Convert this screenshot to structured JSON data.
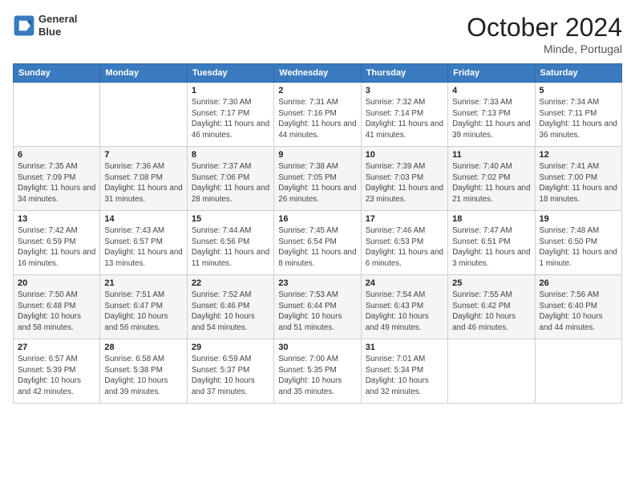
{
  "header": {
    "logo_line1": "General",
    "logo_line2": "Blue",
    "month": "October 2024",
    "location": "Minde, Portugal"
  },
  "weekdays": [
    "Sunday",
    "Monday",
    "Tuesday",
    "Wednesday",
    "Thursday",
    "Friday",
    "Saturday"
  ],
  "weeks": [
    [
      {
        "day": "",
        "info": ""
      },
      {
        "day": "",
        "info": ""
      },
      {
        "day": "1",
        "info": "Sunrise: 7:30 AM\nSunset: 7:17 PM\nDaylight: 11 hours and 46 minutes."
      },
      {
        "day": "2",
        "info": "Sunrise: 7:31 AM\nSunset: 7:16 PM\nDaylight: 11 hours and 44 minutes."
      },
      {
        "day": "3",
        "info": "Sunrise: 7:32 AM\nSunset: 7:14 PM\nDaylight: 11 hours and 41 minutes."
      },
      {
        "day": "4",
        "info": "Sunrise: 7:33 AM\nSunset: 7:13 PM\nDaylight: 11 hours and 39 minutes."
      },
      {
        "day": "5",
        "info": "Sunrise: 7:34 AM\nSunset: 7:11 PM\nDaylight: 11 hours and 36 minutes."
      }
    ],
    [
      {
        "day": "6",
        "info": "Sunrise: 7:35 AM\nSunset: 7:09 PM\nDaylight: 11 hours and 34 minutes."
      },
      {
        "day": "7",
        "info": "Sunrise: 7:36 AM\nSunset: 7:08 PM\nDaylight: 11 hours and 31 minutes."
      },
      {
        "day": "8",
        "info": "Sunrise: 7:37 AM\nSunset: 7:06 PM\nDaylight: 11 hours and 28 minutes."
      },
      {
        "day": "9",
        "info": "Sunrise: 7:38 AM\nSunset: 7:05 PM\nDaylight: 11 hours and 26 minutes."
      },
      {
        "day": "10",
        "info": "Sunrise: 7:39 AM\nSunset: 7:03 PM\nDaylight: 11 hours and 23 minutes."
      },
      {
        "day": "11",
        "info": "Sunrise: 7:40 AM\nSunset: 7:02 PM\nDaylight: 11 hours and 21 minutes."
      },
      {
        "day": "12",
        "info": "Sunrise: 7:41 AM\nSunset: 7:00 PM\nDaylight: 11 hours and 18 minutes."
      }
    ],
    [
      {
        "day": "13",
        "info": "Sunrise: 7:42 AM\nSunset: 6:59 PM\nDaylight: 11 hours and 16 minutes."
      },
      {
        "day": "14",
        "info": "Sunrise: 7:43 AM\nSunset: 6:57 PM\nDaylight: 11 hours and 13 minutes."
      },
      {
        "day": "15",
        "info": "Sunrise: 7:44 AM\nSunset: 6:56 PM\nDaylight: 11 hours and 11 minutes."
      },
      {
        "day": "16",
        "info": "Sunrise: 7:45 AM\nSunset: 6:54 PM\nDaylight: 11 hours and 8 minutes."
      },
      {
        "day": "17",
        "info": "Sunrise: 7:46 AM\nSunset: 6:53 PM\nDaylight: 11 hours and 6 minutes."
      },
      {
        "day": "18",
        "info": "Sunrise: 7:47 AM\nSunset: 6:51 PM\nDaylight: 11 hours and 3 minutes."
      },
      {
        "day": "19",
        "info": "Sunrise: 7:48 AM\nSunset: 6:50 PM\nDaylight: 11 hours and 1 minute."
      }
    ],
    [
      {
        "day": "20",
        "info": "Sunrise: 7:50 AM\nSunset: 6:48 PM\nDaylight: 10 hours and 58 minutes."
      },
      {
        "day": "21",
        "info": "Sunrise: 7:51 AM\nSunset: 6:47 PM\nDaylight: 10 hours and 56 minutes."
      },
      {
        "day": "22",
        "info": "Sunrise: 7:52 AM\nSunset: 6:46 PM\nDaylight: 10 hours and 54 minutes."
      },
      {
        "day": "23",
        "info": "Sunrise: 7:53 AM\nSunset: 6:44 PM\nDaylight: 10 hours and 51 minutes."
      },
      {
        "day": "24",
        "info": "Sunrise: 7:54 AM\nSunset: 6:43 PM\nDaylight: 10 hours and 49 minutes."
      },
      {
        "day": "25",
        "info": "Sunrise: 7:55 AM\nSunset: 6:42 PM\nDaylight: 10 hours and 46 minutes."
      },
      {
        "day": "26",
        "info": "Sunrise: 7:56 AM\nSunset: 6:40 PM\nDaylight: 10 hours and 44 minutes."
      }
    ],
    [
      {
        "day": "27",
        "info": "Sunrise: 6:57 AM\nSunset: 5:39 PM\nDaylight: 10 hours and 42 minutes."
      },
      {
        "day": "28",
        "info": "Sunrise: 6:58 AM\nSunset: 5:38 PM\nDaylight: 10 hours and 39 minutes."
      },
      {
        "day": "29",
        "info": "Sunrise: 6:59 AM\nSunset: 5:37 PM\nDaylight: 10 hours and 37 minutes."
      },
      {
        "day": "30",
        "info": "Sunrise: 7:00 AM\nSunset: 5:35 PM\nDaylight: 10 hours and 35 minutes."
      },
      {
        "day": "31",
        "info": "Sunrise: 7:01 AM\nSunset: 5:34 PM\nDaylight: 10 hours and 32 minutes."
      },
      {
        "day": "",
        "info": ""
      },
      {
        "day": "",
        "info": ""
      }
    ]
  ]
}
